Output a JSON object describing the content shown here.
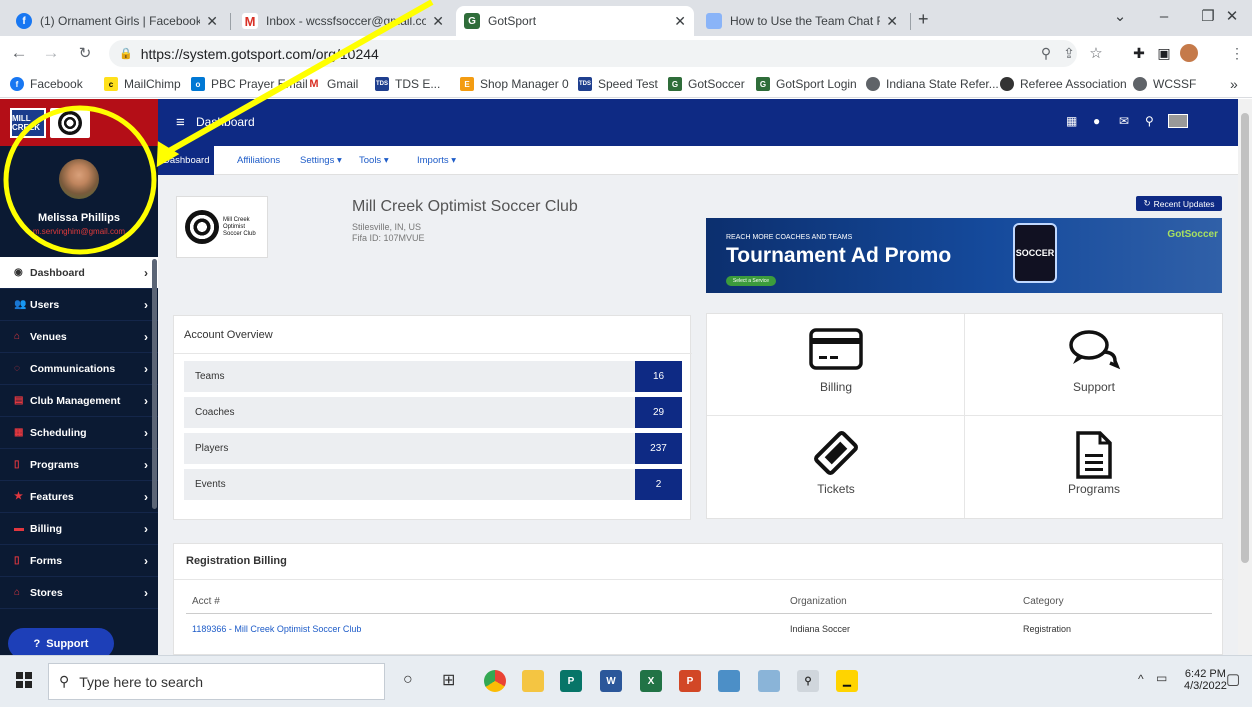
{
  "browser": {
    "tabs": [
      {
        "title": "(1) Ornament Girls | Facebook",
        "icon": "facebook-icon"
      },
      {
        "title": "Inbox - wcssfsoccer@gmail.com",
        "icon": "gmail-icon"
      },
      {
        "title": "GotSport",
        "icon": "gotsport-icon",
        "active": true
      },
      {
        "title": "How to Use the Team Chat Funct",
        "icon": "page-icon"
      }
    ],
    "url": "https://system.gotsport.com/org/10244",
    "bookmarks": [
      "Facebook",
      "MailChimp",
      "PBC Prayer Email",
      "Gmail",
      "TDS E...",
      "Shop Manager 0",
      "Speed Test",
      "GotSoccer",
      "GotSport Login",
      "Indiana State Refer...",
      "Referee Association",
      "WCSSF"
    ],
    "bookmarks_overflow": "»"
  },
  "sidebar": {
    "logo_text": "MILL CREEK",
    "user_name": "Melissa Phillips",
    "user_email": "m.servinghim@gmail.com",
    "items": [
      {
        "label": "Dashboard",
        "icon": "dashboard-icon",
        "active": true
      },
      {
        "label": "Users",
        "icon": "users-icon"
      },
      {
        "label": "Venues",
        "icon": "venue-icon"
      },
      {
        "label": "Communications",
        "icon": "chat-icon"
      },
      {
        "label": "Club Management",
        "icon": "club-icon"
      },
      {
        "label": "Scheduling",
        "icon": "calendar-icon"
      },
      {
        "label": "Programs",
        "icon": "document-icon"
      },
      {
        "label": "Features",
        "icon": "star-icon"
      },
      {
        "label": "Billing",
        "icon": "billing-icon"
      },
      {
        "label": "Forms",
        "icon": "form-icon"
      },
      {
        "label": "Stores",
        "icon": "store-icon"
      }
    ],
    "support_label": "Support"
  },
  "topnav": {
    "title": "Dashboard"
  },
  "subtabs": [
    {
      "label": "Dashboard",
      "active": true
    },
    {
      "label": "Affiliations"
    },
    {
      "label": "Settings ▾"
    },
    {
      "label": "Tools ▾"
    },
    {
      "label": "Imports ▾"
    }
  ],
  "club": {
    "name": "Mill Creek Optimist Soccer Club",
    "location": "Stilesville, IN, US",
    "fifa": "Fifa ID: 107MVUE",
    "logo_text": "Mill Creek Optimist Soccer Club"
  },
  "recent_updates": "Recent Updates",
  "ad": {
    "kicker": "REACH MORE COACHES AND TEAMS",
    "headline": "Tournament Ad Promo",
    "button": "Select a Service",
    "brand": "GotSoccer",
    "badge": "SOCCER"
  },
  "overview": {
    "title": "Account Overview",
    "rows": [
      {
        "label": "Teams",
        "count": "16"
      },
      {
        "label": "Coaches",
        "count": "29"
      },
      {
        "label": "Players",
        "count": "237"
      },
      {
        "label": "Events",
        "count": "2"
      }
    ]
  },
  "tiles": [
    {
      "label": "Billing",
      "icon": "credit-card-icon"
    },
    {
      "label": "Support",
      "icon": "chat-bubbles-icon"
    },
    {
      "label": "Tickets",
      "icon": "ticket-icon"
    },
    {
      "label": "Programs",
      "icon": "document-icon"
    }
  ],
  "registration": {
    "title": "Registration Billing",
    "headers": [
      "Acct #",
      "Organization",
      "Category"
    ],
    "rows": [
      [
        "1189366 - Mill Creek Optimist Soccer Club",
        "Indiana Soccer",
        "Registration"
      ]
    ]
  },
  "taskbar": {
    "search_placeholder": "Type here to search",
    "time": "6:42 PM",
    "date": "4/3/2022"
  },
  "colors": {
    "navy": "#0e2a84",
    "sidebar": "#0b1a33",
    "accent_red": "#e2373f",
    "annotation": "#ffff00"
  }
}
